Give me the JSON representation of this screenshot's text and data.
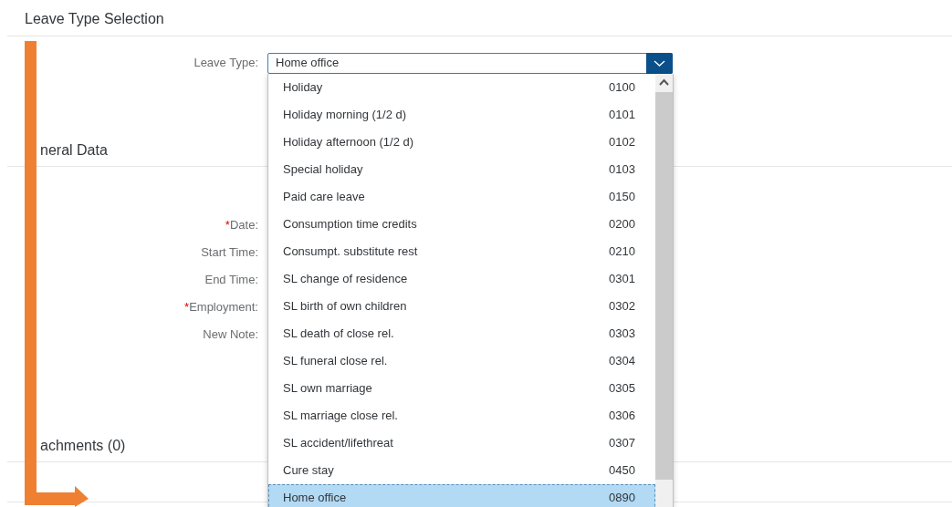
{
  "page_title": "Leave Type Selection",
  "leave_type": {
    "label": "Leave Type:",
    "value": "Home office",
    "expanded": true
  },
  "options": [
    {
      "label": "Holiday",
      "code": "0100",
      "selected": false
    },
    {
      "label": "Holiday morning (1/2 d)",
      "code": "0101",
      "selected": false
    },
    {
      "label": "Holiday afternoon (1/2 d)",
      "code": "0102",
      "selected": false
    },
    {
      "label": "Special holiday",
      "code": "0103",
      "selected": false
    },
    {
      "label": "Paid care leave",
      "code": "0150",
      "selected": false
    },
    {
      "label": "Consumption time credits",
      "code": "0200",
      "selected": false
    },
    {
      "label": "Consumpt. substitute rest",
      "code": "0210",
      "selected": false
    },
    {
      "label": "SL change of residence",
      "code": "0301",
      "selected": false
    },
    {
      "label": "SL birth of own children",
      "code": "0302",
      "selected": false
    },
    {
      "label": "SL death of close rel.",
      "code": "0303",
      "selected": false
    },
    {
      "label": "SL funeral close rel.",
      "code": "0304",
      "selected": false
    },
    {
      "label": "SL own marriage",
      "code": "0305",
      "selected": false
    },
    {
      "label": "SL marriage close rel.",
      "code": "0306",
      "selected": false
    },
    {
      "label": "SL accident/lifethreat",
      "code": "0307",
      "selected": false
    },
    {
      "label": "Cure stay",
      "code": "0450",
      "selected": false
    },
    {
      "label": "Home office",
      "code": "0890",
      "selected": true
    }
  ],
  "general_data": {
    "heading": "neral Data",
    "required_mark": "*",
    "fields": [
      {
        "label": "Date:",
        "required": true
      },
      {
        "label": "Start Time:",
        "required": false
      },
      {
        "label": "End Time:",
        "required": false
      },
      {
        "label": "Employment:",
        "required": true
      },
      {
        "label": "New Note:",
        "required": false
      }
    ]
  },
  "attachments": {
    "heading": "achments (0)"
  }
}
